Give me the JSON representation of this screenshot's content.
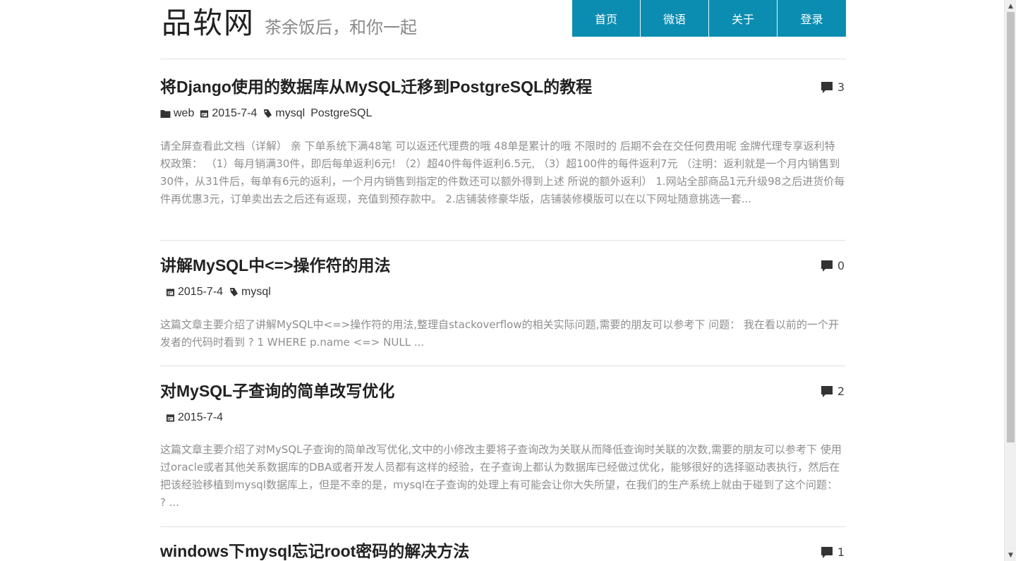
{
  "header": {
    "site_title": "品软网",
    "slogan": "茶余饭后，和你一起",
    "nav": [
      "首页",
      "微语",
      "关于",
      "登录"
    ]
  },
  "posts": [
    {
      "title": "将Django使用的数据库从MySQL迁移到PostgreSQL的教程",
      "comment_count": "3",
      "category": "web",
      "date": "2015-7-4",
      "tags": [
        "mysql",
        "PostgreSQL"
      ],
      "excerpt": "请全屏查看此文档（详解） 亲 下单系统下满48笔 可以返还代理费的哦 48单是累计的哦 不限时的 后期不会在交任何费用呢  金牌代理专享返利特权政策： （1）每月销满30件，即后每单返利6元! （2）超40件每件返利6.5元, （3）超100件的每件返利7元 （注明：返利就是一个月内销售到30件，从31件后，每单有6元的返利，一个月内销售到指定的件数还可以额外得到上述 所说的额外返利） 1.网站全部商品1元升级98之后进货价每件再优惠3元，订单卖出去之后还有返现，充值到预存款中。 2.店铺装修豪华版，店铺装修模版可以在以下网址随意挑选一套..."
    },
    {
      "title": "讲解MySQL中<=>操作符的用法",
      "comment_count": "0",
      "category": "",
      "date": "2015-7-4",
      "tags": [
        "mysql"
      ],
      "excerpt": "这篇文章主要介绍了讲解MySQL中<=>操作符的用法,整理自stackoverflow的相关实际问题,需要的朋友可以参考下 问题： 我在看以前的一个开发者的代码时看到   ? 1 WHERE p.name <=> NULL ..."
    },
    {
      "title": "对MySQL子查询的简单改写优化",
      "comment_count": "2",
      "category": "",
      "date": "2015-7-4",
      "tags": [],
      "excerpt": "这篇文章主要介绍了对MySQL子查询的简单改写优化,文中的小修改主要将子查询改为关联从而降低查询时关联的次数,需要的朋友可以参考下 使用过oracle或者其他关系数据库的DBA或者开发人员都有这样的经验，在子查询上都认为数据库已经做过优化，能够很好的选择驱动表执行，然后在把该经验移植到mysql数据库上，但是不幸的是，mysql在子查询的处理上有可能会让你大失所望，在我们的生产系统上就由于碰到了这个问题： ? ..."
    },
    {
      "title": "windows下mysql忘记root密码的解决方法",
      "comment_count": "1",
      "category": "",
      "date": "",
      "tags": [],
      "excerpt": ""
    }
  ],
  "colors": {
    "nav_bg": "#0b8db2",
    "excerpt_text": "#8e8e8e",
    "title_text": "#222222"
  },
  "icons": {
    "comment": "speech-bubble-icon",
    "category": "folder-icon",
    "date": "calendar-icon",
    "tag": "tag-icon"
  }
}
